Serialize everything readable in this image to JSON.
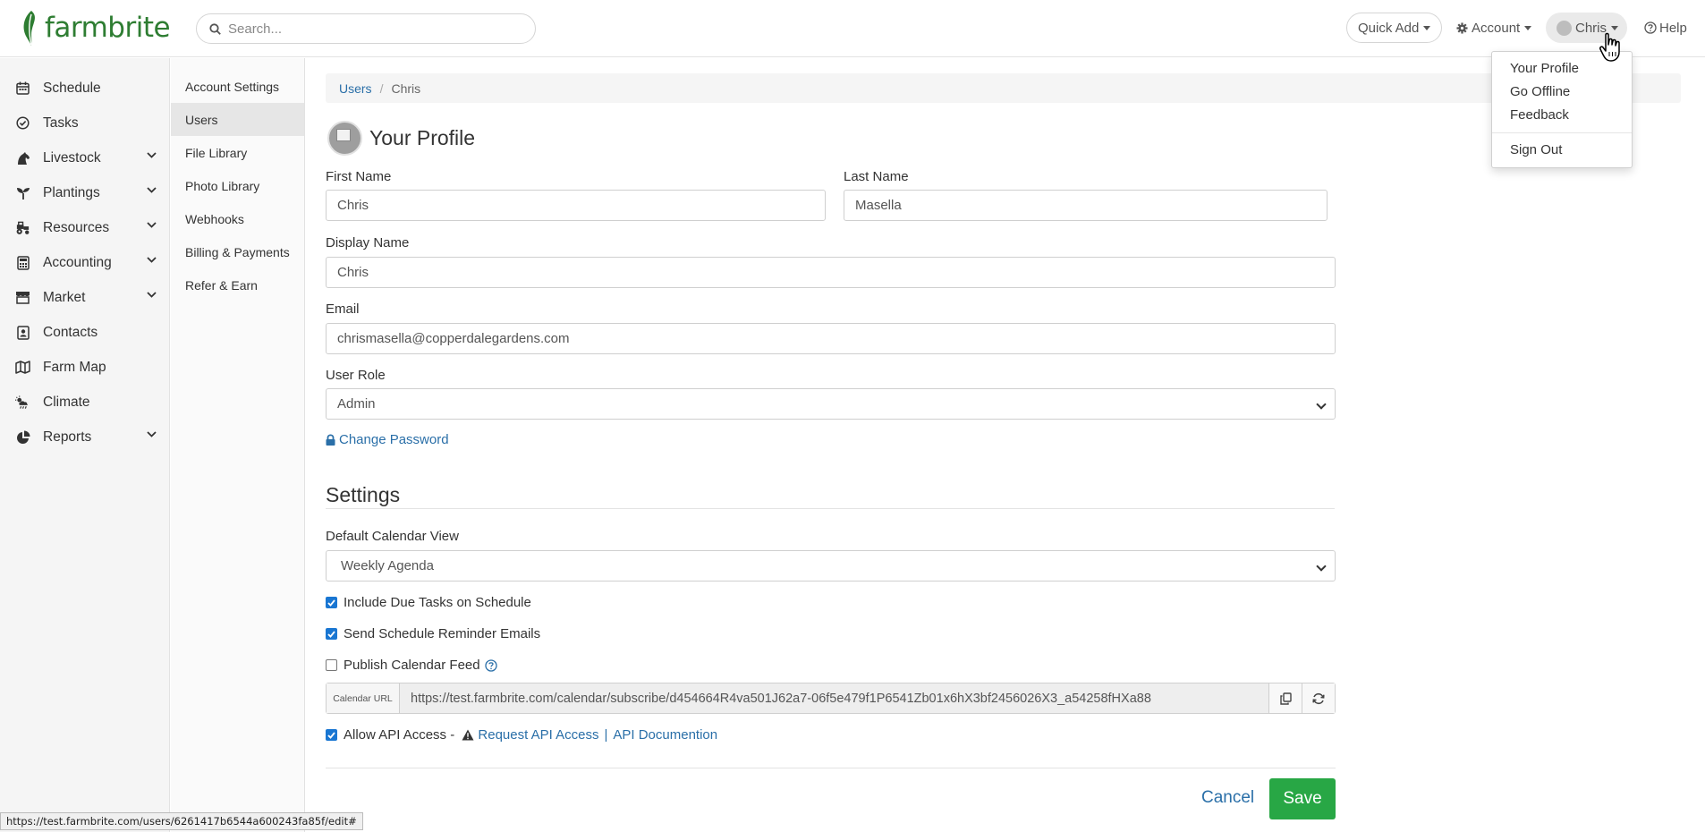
{
  "header": {
    "logo_text": "farmbrite",
    "search_placeholder": "Search...",
    "quick_add_label": "Quick Add",
    "account_label": "Account",
    "user_label": "Chris",
    "help_label": "Help"
  },
  "user_menu": {
    "items": [
      "Your Profile",
      "Go Offline",
      "Feedback"
    ],
    "sign_out": "Sign Out"
  },
  "sidebar": {
    "items": [
      {
        "label": "Schedule",
        "icon": "calendar-icon",
        "has_children": false
      },
      {
        "label": "Tasks",
        "icon": "check-circle-icon",
        "has_children": false
      },
      {
        "label": "Livestock",
        "icon": "horse-icon",
        "has_children": true
      },
      {
        "label": "Plantings",
        "icon": "seedling-icon",
        "has_children": true
      },
      {
        "label": "Resources",
        "icon": "tractor-icon",
        "has_children": true
      },
      {
        "label": "Accounting",
        "icon": "calculator-icon",
        "has_children": true
      },
      {
        "label": "Market",
        "icon": "store-icon",
        "has_children": true
      },
      {
        "label": "Contacts",
        "icon": "contact-card-icon",
        "has_children": false
      },
      {
        "label": "Farm Map",
        "icon": "map-icon",
        "has_children": false
      },
      {
        "label": "Climate",
        "icon": "cloud-sun-rain-icon",
        "has_children": false
      },
      {
        "label": "Reports",
        "icon": "pie-chart-icon",
        "has_children": true
      }
    ]
  },
  "subnav": {
    "items": [
      "Account Settings",
      "Users",
      "File Library",
      "Photo Library",
      "Webhooks",
      "Billing & Payments",
      "Refer & Earn"
    ],
    "active_index": 1
  },
  "breadcrumb": {
    "parent": "Users",
    "current": "Chris",
    "separator": "/"
  },
  "profile": {
    "title": "Your Profile",
    "first_name_label": "First Name",
    "first_name_value": "Chris",
    "last_name_label": "Last Name",
    "last_name_value": "Masella",
    "display_name_label": "Display Name",
    "display_name_value": "Chris",
    "email_label": "Email",
    "email_value": "chrismasella@copperdalegardens.com",
    "role_label": "User Role",
    "role_value": "Admin",
    "change_password_label": "Change Password"
  },
  "settings": {
    "title": "Settings",
    "calendar_view_label": "Default Calendar View",
    "calendar_view_value": "Weekly Agenda",
    "include_due_tasks_label": "Include Due Tasks on Schedule",
    "include_due_tasks_checked": true,
    "reminder_emails_label": "Send Schedule Reminder Emails",
    "reminder_emails_checked": true,
    "publish_feed_label": "Publish Calendar Feed",
    "publish_feed_checked": false,
    "calendar_url_addon": "Calendar URL",
    "calendar_url_value": "https://test.farmbrite.com/calendar/subscribe/d454664R4va501J62a7-06f5e479f1P6541Zb01x6hX3bf2456026X3_a54258fHXa88",
    "api_access_label": "Allow API Access - ",
    "api_access_checked": true,
    "request_api_label": "Request API Access",
    "api_divider": "|",
    "api_docs_label": "API Documention"
  },
  "actions": {
    "cancel_label": "Cancel",
    "save_label": "Save"
  },
  "status_bar": {
    "url": "https://test.farmbrite.com/users/6261417b6544a600243fa85f/edit#"
  },
  "colors": {
    "brand_green": "#2e7d32",
    "link_blue": "#2a6fa8",
    "save_green": "#28a745",
    "checkbox_blue": "#1976d2"
  }
}
